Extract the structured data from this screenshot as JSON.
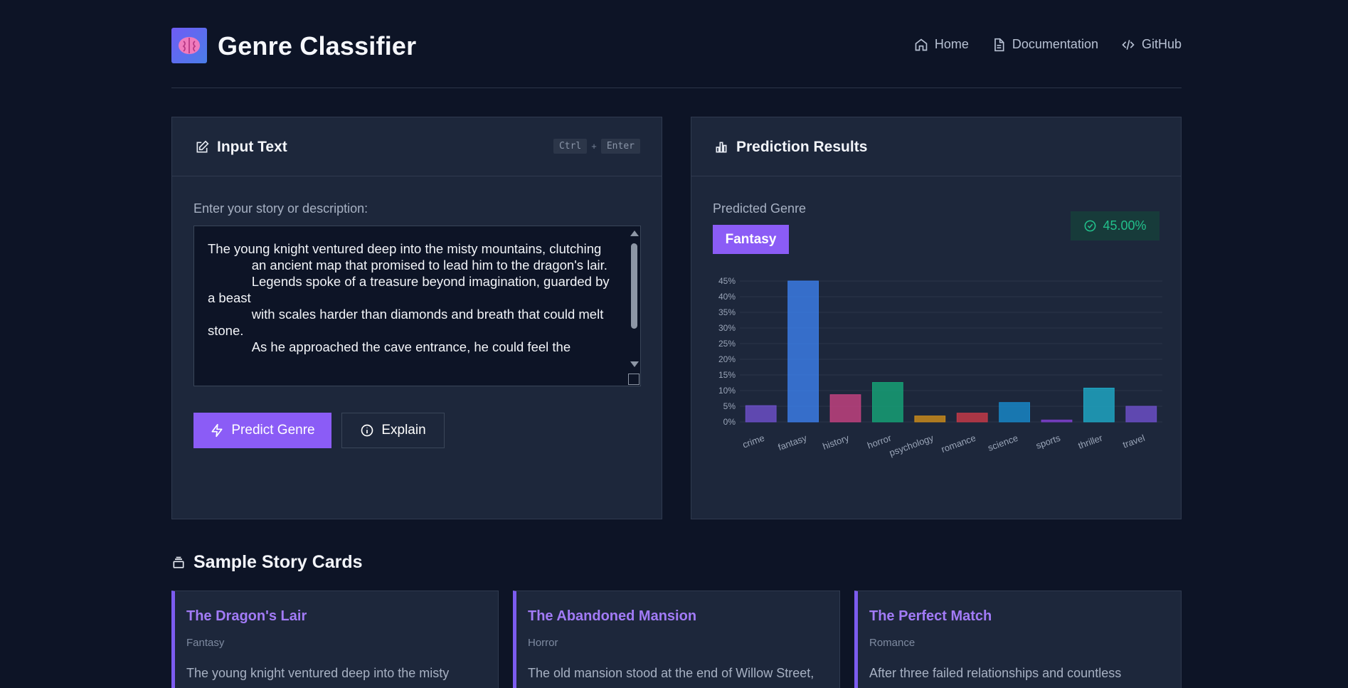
{
  "app": {
    "title": "Genre Classifier",
    "logo_icon": "brain-icon"
  },
  "nav": [
    {
      "label": "Home",
      "icon": "home-icon"
    },
    {
      "label": "Documentation",
      "icon": "document-icon"
    },
    {
      "label": "GitHub",
      "icon": "code-icon"
    }
  ],
  "input_panel": {
    "title": "Input Text",
    "shortcut": {
      "key1": "Ctrl",
      "plus": "+",
      "key2": "Enter"
    },
    "field_label": "Enter your story or description:",
    "text_value": "The young knight ventured deep into the misty mountains, clutching\n            an ancient map that promised to lead him to the dragon's lair.\n            Legends spoke of a treasure beyond imagination, guarded by a beast\n            with scales harder than diamonds and breath that could melt stone.\n            As he approached the cave entrance, he could feel the",
    "predict_button": "Predict Genre",
    "explain_button": "Explain"
  },
  "results_panel": {
    "title": "Prediction Results",
    "predicted_label": "Predicted Genre",
    "predicted_genre": "Fantasy",
    "confidence": "45.00%"
  },
  "chart_data": {
    "type": "bar",
    "categories": [
      "crime",
      "fantasy",
      "history",
      "horror",
      "psychology",
      "romance",
      "science",
      "sports",
      "thriller",
      "travel"
    ],
    "values": [
      5.2,
      45.0,
      8.7,
      12.6,
      1.9,
      2.8,
      6.2,
      0.6,
      10.8,
      5.0
    ],
    "colors": [
      "#6b4fc6",
      "#3b7be4",
      "#c0427f",
      "#16a075",
      "#c78a1c",
      "#c23a48",
      "#1886c6",
      "#7b3fc9",
      "#1fa5c2",
      "#6b4fc6"
    ],
    "ylim": [
      0,
      45
    ],
    "yticks": [
      "0%",
      "5%",
      "10%",
      "15%",
      "20%",
      "25%",
      "30%",
      "35%",
      "40%",
      "45%"
    ],
    "grid": true,
    "title": "",
    "xlabel": "",
    "ylabel": ""
  },
  "samples": {
    "title": "Sample Story Cards",
    "cards": [
      {
        "title": "The Dragon's Lair",
        "genre": "Fantasy",
        "text": "The young knight ventured deep into the misty"
      },
      {
        "title": "The Abandoned Mansion",
        "genre": "Horror",
        "text": "The old mansion stood at the end of Willow Street,"
      },
      {
        "title": "The Perfect Match",
        "genre": "Romance",
        "text": "After three failed relationships and countless"
      }
    ]
  }
}
